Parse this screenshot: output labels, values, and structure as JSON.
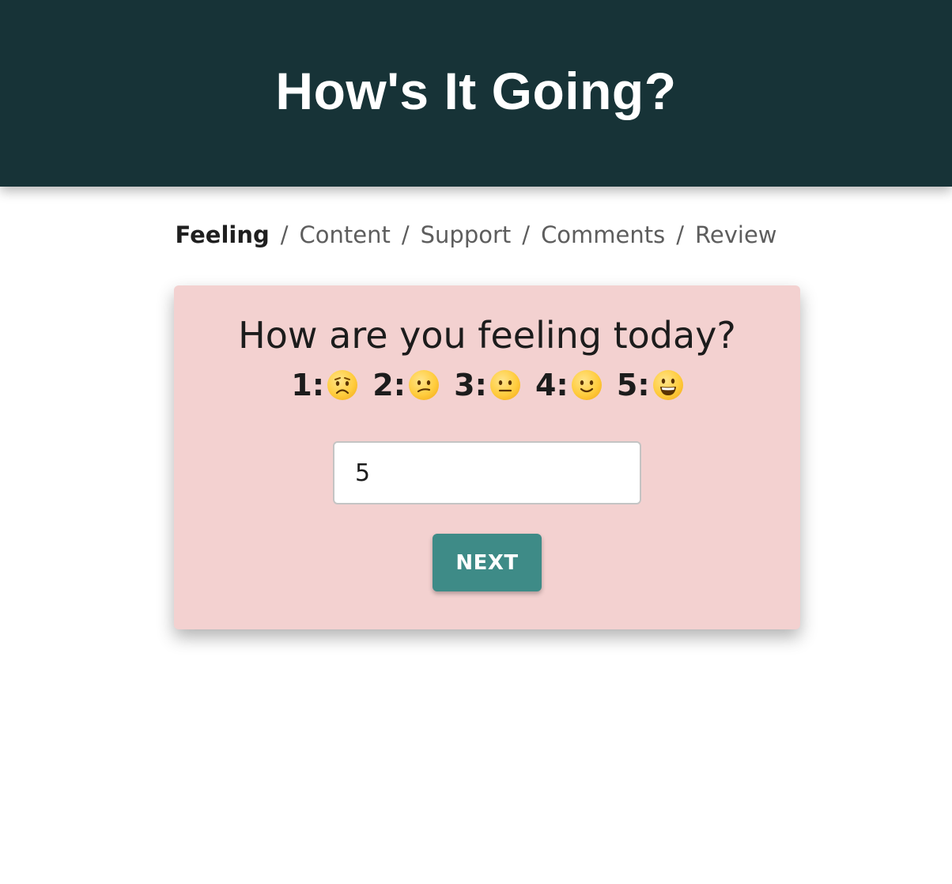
{
  "header": {
    "title": "How's It Going?"
  },
  "breadcrumb": {
    "items": [
      {
        "label": "Feeling",
        "active": true
      },
      {
        "label": "Content",
        "active": false
      },
      {
        "label": "Support",
        "active": false
      },
      {
        "label": "Comments",
        "active": false
      },
      {
        "label": "Review",
        "active": false
      }
    ],
    "separator": "/"
  },
  "card": {
    "question": "How are you feeling today?",
    "scale": [
      {
        "label": "1:",
        "icon": "worried-face-icon"
      },
      {
        "label": "2:",
        "icon": "confused-face-icon"
      },
      {
        "label": "3:",
        "icon": "neutral-face-icon"
      },
      {
        "label": "4:",
        "icon": "slightly-smiling-face-icon"
      },
      {
        "label": "5:",
        "icon": "grinning-face-icon"
      }
    ],
    "input_value": "5",
    "next_label": "NEXT"
  },
  "colors": {
    "header_bg": "#173337",
    "card_bg": "#f3d1d0",
    "button_bg": "#3e8b87"
  }
}
